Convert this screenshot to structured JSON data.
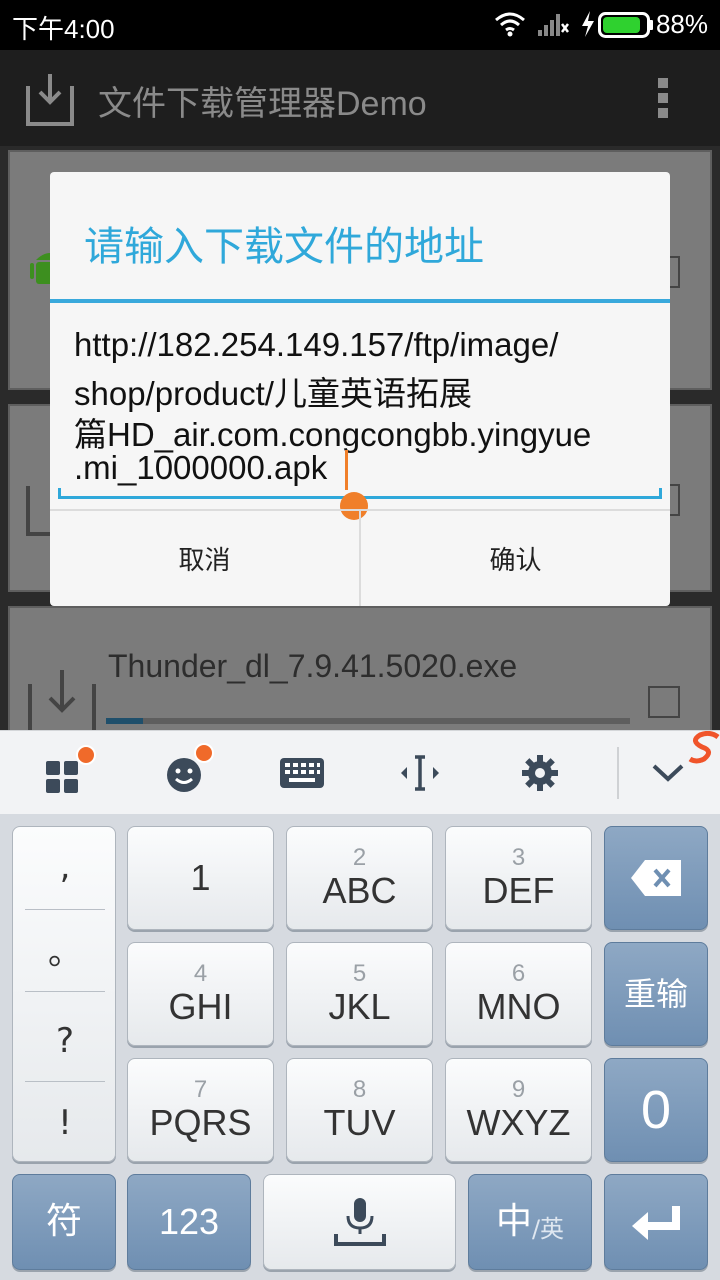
{
  "status_bar": {
    "time": "下午4:00",
    "battery_percent": "88%",
    "battery_level": 0.88,
    "icons": [
      "wifi-icon",
      "signal-icon",
      "charging-icon",
      "battery-icon"
    ]
  },
  "app_bar": {
    "title": "文件下载管理器Demo",
    "icons": [
      "download-icon",
      "overflow-menu-icon"
    ]
  },
  "download_list": {
    "visible_item_filename": "Thunder_dl_7.9.41.5020.exe",
    "visible_item_progress": 0.07
  },
  "dialog": {
    "title": "请输入下载文件的地址",
    "url_lines": [
      "http://182.254.149.157/ftp/image/",
      "shop/product/儿童英语拓展",
      "篇HD_air.com.congcongbb.yingyue",
      ".mi_1000000.apk"
    ],
    "cancel_label": "取消",
    "confirm_label": "确认"
  },
  "keyboard": {
    "toolbar_icons": [
      "apps-grid-icon",
      "emoji-icon",
      "keyboard-icon",
      "cursor-move-icon",
      "settings-gear-icon",
      "collapse-chevron-icon"
    ],
    "punctuation": [
      ",",
      "。",
      "?",
      "!"
    ],
    "keys": {
      "k1": {
        "main": "1",
        "sub": ""
      },
      "k2": {
        "main": "ABC",
        "sub": "2"
      },
      "k3": {
        "main": "DEF",
        "sub": "3"
      },
      "k4": {
        "main": "GHI",
        "sub": "4"
      },
      "k5": {
        "main": "JKL",
        "sub": "5"
      },
      "k6": {
        "main": "MNO",
        "sub": "6"
      },
      "k7": {
        "main": "PQRS",
        "sub": "7"
      },
      "k8": {
        "main": "TUV",
        "sub": "8"
      },
      "k9": {
        "main": "WXYZ",
        "sub": "9"
      }
    },
    "reinput_label": "重输",
    "zero_label": "0",
    "symbol_label": "符",
    "num_label": "123",
    "lang_main": "中",
    "lang_sub": "/英"
  },
  "colors": {
    "accent_blue": "#2fa8da",
    "cursor_orange": "#f07f2a",
    "badge_orange": "#f06a2a"
  }
}
